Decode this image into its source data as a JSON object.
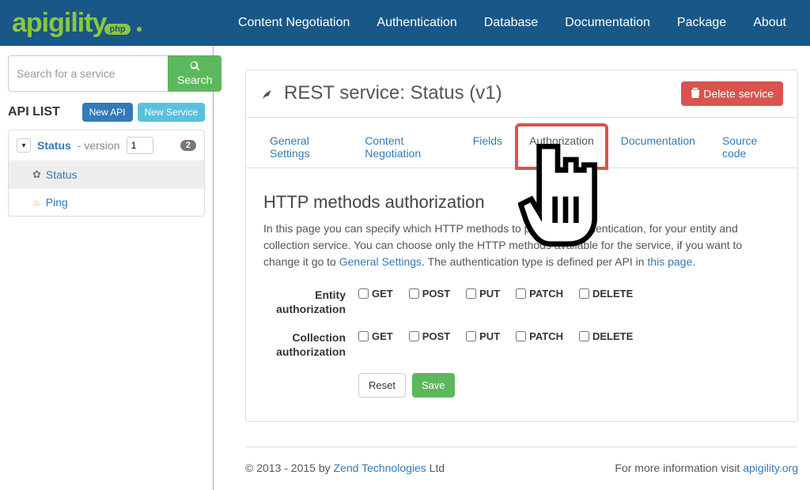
{
  "brand": {
    "name": "apigility",
    "badge": "php"
  },
  "nav": {
    "items": [
      "Content Negotiation",
      "Authentication",
      "Database",
      "Documentation",
      "Package",
      "About"
    ]
  },
  "sidebar": {
    "search_placeholder": "Search for a service",
    "search_btn": "Search",
    "title": "API LIST",
    "new_api": "New API",
    "new_service": "New Service",
    "api": {
      "name": "Status",
      "version_label": "version",
      "version": "1",
      "count": "2"
    },
    "services": [
      {
        "name": "Status",
        "icon": "leaf",
        "active": true
      },
      {
        "name": "Ping",
        "icon": "flame",
        "active": false
      }
    ]
  },
  "page": {
    "title": "REST service: Status (v1)",
    "delete_btn": "Delete service",
    "tabs": [
      "General Settings",
      "Content Negotiation",
      "Fields",
      "Authorization",
      "Documentation",
      "Source code"
    ],
    "active_tab": "Authorization",
    "section_title": "HTTP methods authorization",
    "desc_prefix": "In this page you can specify which HTTP methods to put under authentication, for your entity and collection service. You can choose only the HTTP methods available for the service, if you want to change it go to ",
    "desc_link1": "General Settings",
    "desc_mid": ". The authentication type is defined per API in ",
    "desc_link2": "this page",
    "desc_suffix": ".",
    "rows": [
      {
        "label": "Entity authorization"
      },
      {
        "label": "Collection authorization"
      }
    ],
    "methods": [
      "GET",
      "POST",
      "PUT",
      "PATCH",
      "DELETE"
    ],
    "reset": "Reset",
    "save": "Save"
  },
  "footer": {
    "copy_prefix": "© 2013 - 2015 by ",
    "copy_link": "Zend Technologies",
    "copy_suffix": " Ltd",
    "info_prefix": "For more information visit ",
    "info_link": "apigility.org"
  }
}
